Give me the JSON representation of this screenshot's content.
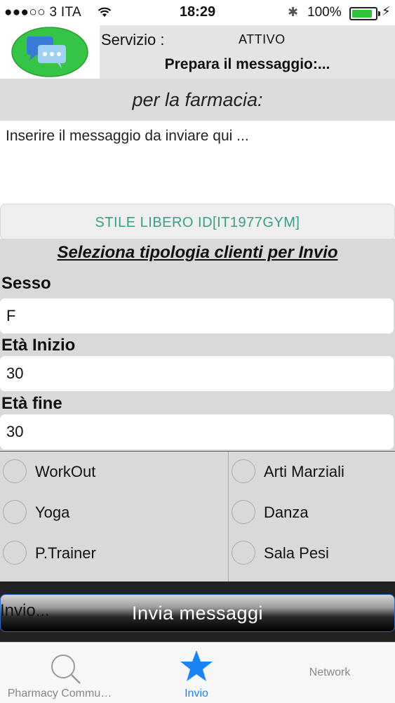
{
  "status_bar": {
    "carrier": "●●●○○ 3 ITA",
    "time": "18:29",
    "battery_percent": "100%",
    "battery_level": 1.0
  },
  "header": {
    "service_label": "Servizio :",
    "service_status": "ATTIVO",
    "prepare_label": "Prepara il messaggio:..."
  },
  "pharmacy_label": "per la farmacia:",
  "message_placeholder": "Inserire il messaggio  da inviare qui ...",
  "style_button_label": "STILE LIBERO ID[IT1977GYM]",
  "section_title": "Seleziona tipologia clienti per Invio",
  "fields": {
    "sex_label": "Sesso",
    "sex_value": "F",
    "age_start_label": "Età Inizio",
    "age_start_value": "30",
    "age_end_label": "Età fine",
    "age_end_value": "30"
  },
  "categories": [
    {
      "label": "WorkOut",
      "selected": false
    },
    {
      "label": "Arti Marziali",
      "selected": false
    },
    {
      "label": "Yoga",
      "selected": false
    },
    {
      "label": "Danza",
      "selected": false
    },
    {
      "label": "P.Trainer",
      "selected": false
    },
    {
      "label": "Sala Pesi",
      "selected": false
    }
  ],
  "send_button_label": "Invia messaggi",
  "sending_label": "Invio...",
  "tabs": [
    {
      "label": "Pharmacy  Commu…",
      "icon": "search-icon",
      "active": false
    },
    {
      "label": "Invio",
      "icon": "star-icon",
      "active": true
    },
    {
      "label": "Network",
      "icon": "",
      "active": false
    }
  ],
  "colors": {
    "accent": "#1a84f5",
    "style_text": "#3b9e8a",
    "battery": "#30c43a",
    "logo_green": "#35c445"
  }
}
